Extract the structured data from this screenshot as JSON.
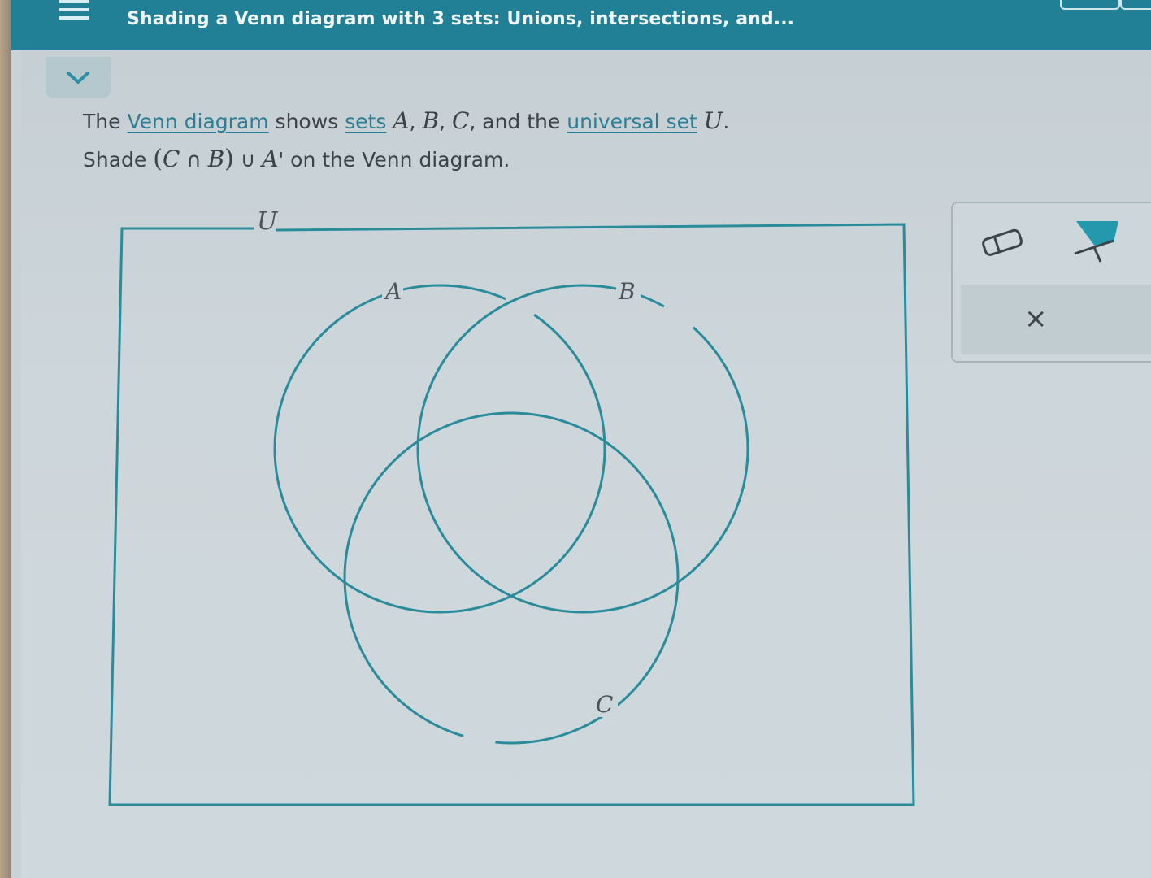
{
  "header": {
    "title": "Shading a Venn diagram with 3 sets: Unions, intersections, and..."
  },
  "question": {
    "line1": {
      "t1": "The ",
      "link_venn": "Venn diagram",
      "t2": " shows ",
      "link_sets": "sets",
      "t3": " ",
      "set_a": "A",
      "t4": ", ",
      "set_b": "B",
      "t5": ", ",
      "set_c": "C",
      "t6": ", and the ",
      "link_universal": "universal set",
      "t7": " ",
      "set_u": "U",
      "t8": "."
    },
    "line2": {
      "t1": "Shade ",
      "open_paren": "(",
      "c": "C",
      "intersect": " ∩ ",
      "b": "B",
      "close_paren": ")",
      "union": " ∪ ",
      "a": "A",
      "prime": "'",
      "t2": " on the Venn diagram."
    }
  },
  "venn": {
    "universe_label": "U",
    "set_labels": {
      "a": "A",
      "b": "B",
      "c": "C"
    },
    "stroke_color": "#2a8b9b",
    "frame_color": "#2a8b9b"
  },
  "toolbox": {
    "eraser_icon": "eraser-icon",
    "fill_icon": "paint-fill-icon",
    "clear_symbol": "×"
  },
  "colors": {
    "header_bg": "#217f96",
    "link": "#2d7e94",
    "fill_tool": "#2499ad"
  }
}
